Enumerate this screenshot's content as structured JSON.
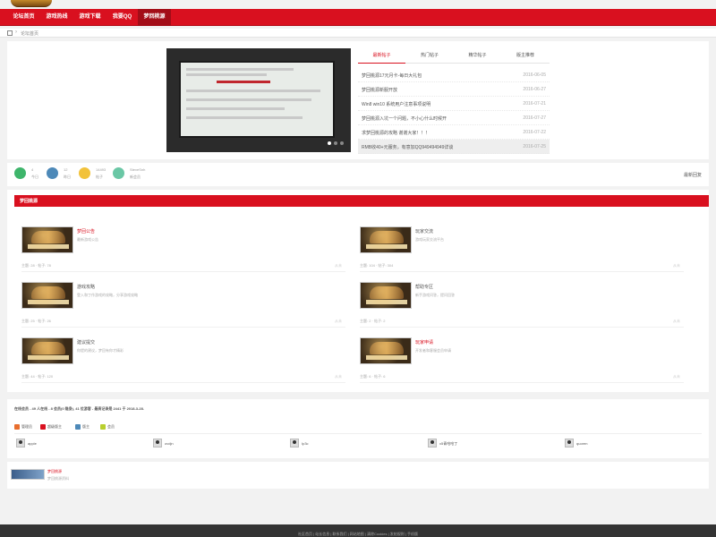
{
  "nav": {
    "items": [
      "论坛首页",
      "游戏热线",
      "游戏下载",
      "我要QQ",
      "梦回桃源"
    ],
    "active_index": 4
  },
  "breadcrumb": {
    "current": "论坛首页"
  },
  "slider": {
    "dots": 3,
    "active_dot": 0
  },
  "tabs": [
    "最新帖子",
    "热门帖子",
    "精华帖子",
    "版主推荐"
  ],
  "tab_active_index": 0,
  "posts": [
    {
      "title": "梦回桃源17元月卡-每日大礼包",
      "date": "2016-06-05"
    },
    {
      "title": "梦回桃源新服开放",
      "date": "2016-06-27"
    },
    {
      "title": "Win8 win10 系统用户注意事项说明",
      "date": "2016-07-21"
    },
    {
      "title": "梦回桃源入坑一个问题，不小心什么时候开",
      "date": "2016-07-27"
    },
    {
      "title": "求梦回桃源的攻略 谢谢大家！！！",
      "date": "2016-07-22"
    },
    {
      "title": "RMB收40+元服务，有意加QQ949494949详谈",
      "date": "2016-07-25"
    }
  ],
  "highlight_post_index": 5,
  "stats": [
    {
      "num": "4",
      "label": "今日",
      "color": "#3eb56b"
    },
    {
      "num": "12",
      "label": "昨日",
      "color": "#4d89b8"
    },
    {
      "num": "14493",
      "label": "帖子",
      "color": "#f2c23a"
    },
    {
      "num": "SteveSnh",
      "label": "新会员",
      "color": "#6ac7a5"
    }
  ],
  "stats_link": "最新回复",
  "section": {
    "title": "梦回桃源",
    "forums": [
      {
        "name": "梦回公告",
        "desc": "最新游戏公告",
        "count": "主题: 28 · 帖子: 78",
        "latest": "从未",
        "red": true
      },
      {
        "name": "玩家交流",
        "desc": "游戏玩家交流平台",
        "count": "主题: 104 · 帖子: 304",
        "latest": "从未",
        "red": false
      },
      {
        "name": "游戏攻略",
        "desc": "登入和丁作游戏的攻略，分享游戏攻略",
        "count": "主题: 25 · 帖子: 26",
        "latest": "从未",
        "red": false
      },
      {
        "name": "帮助专区",
        "desc": "新手游戏问答，提问回答",
        "count": "主题: 2 · 帖子: 2",
        "latest": "从未",
        "red": false
      },
      {
        "name": "建议提交",
        "desc": "你提的建议，梦回有你才精彩",
        "count": "主题: 44 · 帖子: 120",
        "latest": "从未",
        "red": false
      },
      {
        "name": "玩家申请",
        "desc": "开发者和客服会员申请",
        "count": "主题: 6 · 帖子: 6",
        "latest": "从未",
        "red": true
      }
    ]
  },
  "online": {
    "title": "在线会员 - 49 人在线 - 8 会员(0 隐身), 41 位游客 - 最高记录是 2441 于 2018-3-28.",
    "legend": [
      {
        "label": "管理员",
        "color": "#e86e2e"
      },
      {
        "label": "超级版主",
        "color": "#d9101f"
      },
      {
        "label": "版主",
        "color": "#4d89b8"
      },
      {
        "label": "会员",
        "color": "#b8cf2e"
      }
    ],
    "users": [
      "apple",
      "ovdjn",
      "Ip3c",
      "x5青哈哈丁",
      "quoren"
    ]
  },
  "links": {
    "name": "梦回桃源",
    "desc": "梦回桃源资料"
  },
  "footer": {
    "text": "社区首页 | 站长信息 | 联系我们 | 网站地图 | 清除Cookies | 发帖规则 | 手机版"
  },
  "colors": {
    "brand": "#d9101f",
    "nav_active": "#a30d18"
  }
}
